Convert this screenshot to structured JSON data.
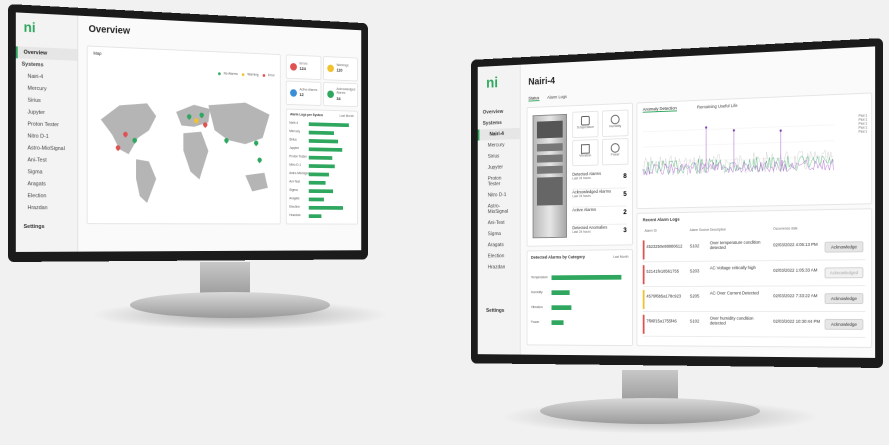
{
  "left_app": {
    "logo": "ni",
    "title": "Overview",
    "nav": [
      "Overview",
      "Systems",
      "Nairi-4",
      "Mercury",
      "Sirius",
      "Jupyter",
      "Proton Tester",
      "Nitro D-1",
      "Astro-MioSignal",
      "Ani-Test",
      "Sigma",
      "Aragats",
      "Election",
      "Hrazdan"
    ],
    "settings": "Settings",
    "map_title": "Map",
    "legend": [
      "No Alarms",
      "Warning",
      "Error"
    ],
    "stats": [
      {
        "label": "Errors",
        "value": "124",
        "color": "#e05252"
      },
      {
        "label": "Warnings",
        "value": "110",
        "color": "#f2c12e"
      },
      {
        "label": "Active Alarms",
        "value": "12",
        "color": "#3a8ed6"
      },
      {
        "label": "Acknowledged Alarms",
        "value": "34",
        "color": "#2fa75f"
      }
    ],
    "alarm_chart_title": "Alarm Logs per System",
    "alarm_chart_filter": "Last Month",
    "alarm_chart_systems": [
      "Nairi-4",
      "Mercury",
      "Sirius",
      "Jupyter",
      "Proton Tester",
      "Nitro D-1",
      "Astro-MioSignal",
      "Ani-Test",
      "Sigma",
      "Aragats",
      "Election",
      "Hrazdan"
    ],
    "alarm_chart_values": [
      96,
      60,
      70,
      80,
      55,
      62,
      48,
      40,
      58,
      36,
      82,
      30
    ]
  },
  "right_app": {
    "logo": "ni",
    "title": "Nairi-4",
    "tabs": [
      "Status",
      "Alarm Logs"
    ],
    "nav": [
      "Overview",
      "Systems",
      "Nairi-4",
      "Mercury",
      "Sirius",
      "Jupyter",
      "Proton Tester",
      "Nitro D-1",
      "Astro-MioSignal",
      "Ani-Test",
      "Sigma",
      "Aragats",
      "Election",
      "Hrazdan"
    ],
    "settings": "Settings",
    "sensors": [
      "Temperature",
      "Humidity",
      "Vibration",
      "Power"
    ],
    "counts": [
      {
        "label": "Detected Alarms",
        "sub": "Last 24 hours",
        "value": "8"
      },
      {
        "label": "Acknowledged Alarms",
        "sub": "Last 24 hours",
        "value": "5"
      },
      {
        "label": "Active Alarms",
        "sub": "",
        "value": "2"
      },
      {
        "label": "Detected Anomalies",
        "sub": "Last 24 hours",
        "value": "3"
      }
    ],
    "category_title": "Detected Alarms by Category",
    "category_filter": "Last Month",
    "categories": [
      "Temperature",
      "Humidity",
      "Vibration",
      "Power"
    ],
    "category_values": [
      70,
      18,
      20,
      12
    ],
    "chart_tabs": [
      "Anomaly Detection",
      "Remaining Useful Life"
    ],
    "chart_legend": [
      "Plot 1",
      "Plot 1",
      "Plot 1",
      "Plot 1",
      "Plot 1"
    ],
    "recent_title": "Recent Alarm Logs",
    "recent_headers": [
      "Alarm ID",
      "Alarm Source",
      "Description",
      "Occurrence date"
    ],
    "recent_rows": [
      {
        "id": "4523250e88880612",
        "src": "S102",
        "desc": "Over temperature condition detected",
        "date": "02/03/2022 4:05:13 PM",
        "action": "Acknowledge",
        "color": "#e05252",
        "enabled": true
      },
      {
        "id": "52141fe18561755",
        "src": "S203",
        "desc": "AC Voltage critically high",
        "date": "02/03/2022 1:05:33 AM",
        "action": "Acknowledged",
        "color": "#e05252",
        "enabled": false
      },
      {
        "id": "4579f6b5a178c923",
        "src": "S205",
        "desc": "AC Over Current Detected",
        "date": "02/03/2022 7:33:22 AM",
        "action": "Acknowledge",
        "color": "#f2c12e",
        "enabled": true
      },
      {
        "id": "7f96f15a1755f46",
        "src": "S102",
        "desc": "Over humidity condition detected",
        "date": "02/03/2022 10:30:44 PM",
        "action": "Acknowledge",
        "color": "#e05252",
        "enabled": true
      }
    ]
  }
}
